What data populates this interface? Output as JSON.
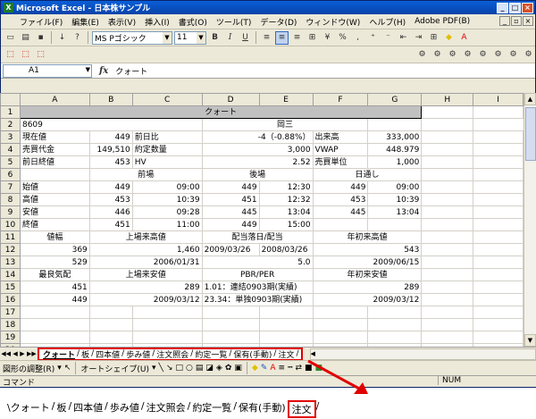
{
  "window": {
    "title": "Microsoft Excel - 日本株サンプル",
    "min": "_",
    "max": "□",
    "close": "×"
  },
  "menu": {
    "items": [
      "ファイル(F)",
      "編集(E)",
      "表示(V)",
      "挿入(I)",
      "書式(O)",
      "ツール(T)",
      "データ(D)",
      "ウィンドウ(W)",
      "ヘルプ(H)",
      "Adobe PDF(B)"
    ]
  },
  "font_toolbar": {
    "font_name": "MS Pゴシック",
    "font_size": "11",
    "bold": "B",
    "italic": "I",
    "underline": "U",
    "percent": "%"
  },
  "formula_bar": {
    "name_box": "A1",
    "fx": "fx",
    "value": "クォート"
  },
  "columns": [
    "A",
    "B",
    "C",
    "D",
    "E",
    "F",
    "G",
    "H",
    "I"
  ],
  "rows": [
    {
      "n": "1",
      "cells": []
    },
    {
      "n": "2",
      "cells": [
        "8609",
        "",
        "",
        "岡三",
        "",
        "",
        ""
      ]
    },
    {
      "n": "3",
      "cells": [
        "現在値",
        "449",
        "前日比",
        "-4（-0.88%）",
        "",
        "出来高",
        "333,000"
      ]
    },
    {
      "n": "4",
      "cells": [
        "売買代金",
        "149,510",
        "約定数量",
        "3,000",
        "",
        "VWAP",
        "448.979"
      ]
    },
    {
      "n": "5",
      "cells": [
        "前日終値",
        "453",
        "HV",
        "2.52",
        "",
        "売買単位",
        "1,000"
      ]
    },
    {
      "n": "6",
      "cells": [
        "",
        "前場",
        "",
        "後場",
        "",
        "日通し",
        ""
      ]
    },
    {
      "n": "7",
      "cells": [
        "始値",
        "449",
        "09:00",
        "449",
        "12:30",
        "449",
        "09:00"
      ]
    },
    {
      "n": "8",
      "cells": [
        "高値",
        "453",
        "10:39",
        "451",
        "12:32",
        "453",
        "10:39"
      ]
    },
    {
      "n": "9",
      "cells": [
        "安値",
        "446",
        "09:28",
        "445",
        "13:04",
        "445",
        "13:04"
      ]
    },
    {
      "n": "10",
      "cells": [
        "終値",
        "451",
        "11:00",
        "449",
        "15:00",
        "",
        ""
      ]
    },
    {
      "n": "11",
      "cells": [
        "値幅",
        "上場来高値",
        "",
        "配当落日/配当",
        "",
        "年初来高値",
        ""
      ]
    },
    {
      "n": "12",
      "cells": [
        "369",
        "",
        "1,460",
        "2009/03/26",
        "2008/03/26",
        "",
        "543"
      ]
    },
    {
      "n": "13",
      "cells": [
        "529",
        "",
        "2006/01/31",
        "",
        "5.0",
        "",
        "2009/06/15"
      ]
    },
    {
      "n": "14",
      "cells": [
        "最良気配",
        "上場来安値",
        "",
        "PBR/PER",
        "",
        "年初来安値",
        ""
      ]
    },
    {
      "n": "15",
      "cells": [
        "451",
        "",
        "289",
        "1.01：連結0903期(実績)",
        "",
        "",
        "289"
      ]
    },
    {
      "n": "16",
      "cells": [
        "449",
        "",
        "2009/03/12",
        "23.34：単独0903期(実績)",
        "",
        "",
        "2009/03/12"
      ]
    },
    {
      "n": "17",
      "cells": []
    },
    {
      "n": "18",
      "cells": []
    },
    {
      "n": "19",
      "cells": []
    },
    {
      "n": "20",
      "cells": []
    },
    {
      "n": "21",
      "cells": []
    },
    {
      "n": "22",
      "cells": []
    }
  ],
  "sheet_title": "クォート",
  "sheet_tabs": [
    "クォート",
    "板",
    "四本値",
    "歩み値",
    "注文照会",
    "約定一覧",
    "保有(手動)",
    "注文"
  ],
  "drawing_toolbar": {
    "draw_menu": "図形の調整(R)",
    "autoshape": "オートシェイプ(U)"
  },
  "status": {
    "left": "コマンド",
    "num": "NUM"
  },
  "bottom_tabs": [
    "\\クォート",
    "板",
    "四本値",
    "歩み値",
    "注文照会",
    "約定一覧",
    "保有(手動)",
    "注文"
  ],
  "colors": {
    "highlight": "#e00000",
    "titlebar": "#0a5fd8"
  }
}
